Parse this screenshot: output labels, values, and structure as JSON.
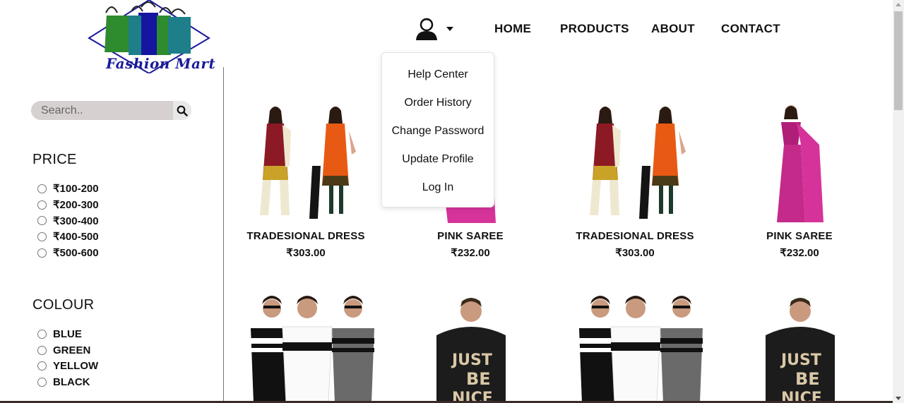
{
  "brand": {
    "name": "Fashion Mart"
  },
  "header": {
    "nav": [
      "HOME",
      "PRODUCTS",
      "ABOUT",
      "CONTACT"
    ],
    "user_icon": "user-icon"
  },
  "dropdown": {
    "items": [
      "Help Center",
      "Order History",
      "Change Password",
      "Update Profile",
      "Log In"
    ]
  },
  "sidebar": {
    "search": {
      "placeholder": "Search..",
      "icon": "search-icon"
    },
    "price": {
      "title": "PRICE",
      "options": [
        "₹100-200",
        "₹200-300",
        "₹300-400",
        "₹400-500",
        "₹500-600"
      ]
    },
    "colour": {
      "title": "COLOUR",
      "options": [
        "BLUE",
        "GREEN",
        "YELLOW",
        "BLACK"
      ]
    }
  },
  "products": [
    {
      "name": "TRADESIONAL DRESS",
      "price": "₹303.00"
    },
    {
      "name": "PINK SAREE",
      "price": "₹232.00"
    },
    {
      "name": "TRADESIONAL DRESS",
      "price": "₹303.00"
    },
    {
      "name": "PINK SAREE",
      "price": "₹232.00"
    }
  ],
  "colors": {
    "bag_green": "#2e8b2e",
    "bag_blue": "#1515a0",
    "bag_teal": "#1e7f8a",
    "logo_text": "#1a1a9a",
    "search_bg": "#d7d0d0"
  }
}
